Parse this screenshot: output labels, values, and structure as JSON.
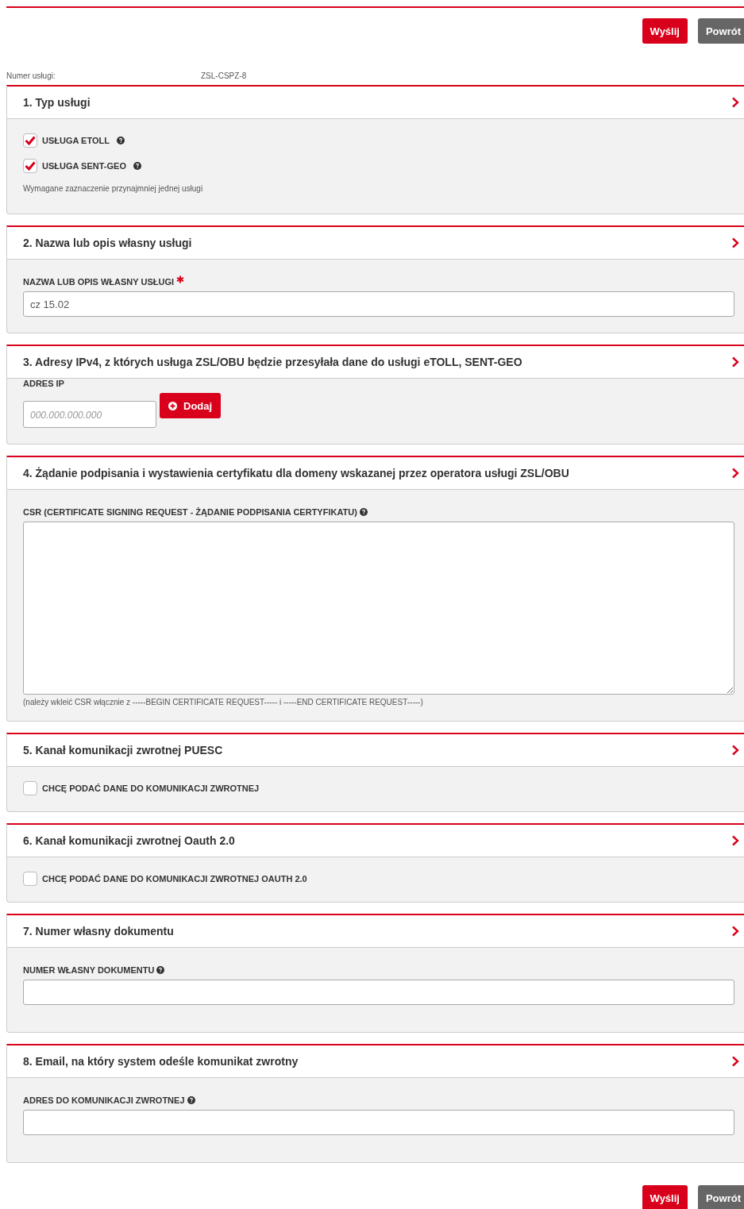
{
  "actions_top": [
    {
      "label": "Wyślij",
      "kind": "primary"
    },
    {
      "label": "Powrót",
      "kind": "secondary"
    }
  ],
  "service_number": {
    "label": "Numer usługi:",
    "value": "ZSL-CSPZ-8"
  },
  "sections": [
    {
      "title": "1. Typ usługi",
      "expanded": true,
      "fields": [
        {
          "kind": "checkbox",
          "label": "USŁUGA ETOLL",
          "checked": true,
          "help": true
        },
        {
          "kind": "checkbox",
          "label": "USŁUGA SENT-GEO",
          "checked": true,
          "help": true
        },
        {
          "kind": "note",
          "text": "Wymagane zaznaczenie przynajmniej jednej usługi"
        }
      ]
    },
    {
      "title": "2. Nazwa lub opis własny usługi",
      "expanded": true,
      "fields": [
        {
          "kind": "text",
          "label": "NAZWA LUB OPIS WŁASNY USŁUGI",
          "required": true,
          "value": "cz 15.02"
        }
      ]
    },
    {
      "title": "3. Adresy IPv4, z których usługa ZSL/OBU będzie przesyłała dane do usługi eTOLL, SENT-GEO",
      "expanded": true,
      "fields": [
        {
          "kind": "ip",
          "label": "ADRES IP",
          "placeholder": "000.000.000.000",
          "button": "Dodaj"
        }
      ]
    },
    {
      "title": "4. Żądanie podpisania i wystawienia certyfikatu dla domeny wskazanej przez operatora usługi ZSL/OBU",
      "expanded": true,
      "fields": [
        {
          "kind": "textarea",
          "label": "CSR (CERTIFICATE SIGNING REQUEST - ŻĄDANIE PODPISANIA CERTYFIKATU)",
          "help": true,
          "note": "(należy wkleić CSR włącznie z -----BEGIN CERTIFICATE REQUEST----- i -----END CERTIFICATE REQUEST-----)"
        }
      ]
    },
    {
      "title": "5. Kanał komunikacji zwrotnej PUESC",
      "expanded": true,
      "fields": [
        {
          "kind": "checkbox",
          "label": "CHCĘ PODAĆ DANE DO KOMUNIKACJI ZWROTNEJ",
          "checked": false,
          "help": false
        }
      ]
    },
    {
      "title": "6. Kanał komunikacji zwrotnej Oauth 2.0",
      "expanded": true,
      "fields": [
        {
          "kind": "checkbox",
          "label": "CHCĘ PODAĆ DANE DO KOMUNIKACJI ZWROTNEJ OAUTH 2.0",
          "checked": false,
          "help": false
        }
      ]
    },
    {
      "title": "7. Numer własny dokumentu",
      "expanded": true,
      "fields": [
        {
          "kind": "text",
          "label": "NUMER WŁASNY DOKUMENTU",
          "help": true
        }
      ]
    },
    {
      "title": "8. Email, na który system odeśle komunikat zwrotny",
      "expanded": true,
      "fields": [
        {
          "kind": "text",
          "label": "ADRES DO KOMUNIKACJI ZWROTNEJ",
          "help": true
        }
      ]
    }
  ],
  "actions_bottom": [
    {
      "label": "Wyślij",
      "kind": "primary"
    },
    {
      "label": "Powrót",
      "kind": "secondary"
    }
  ]
}
